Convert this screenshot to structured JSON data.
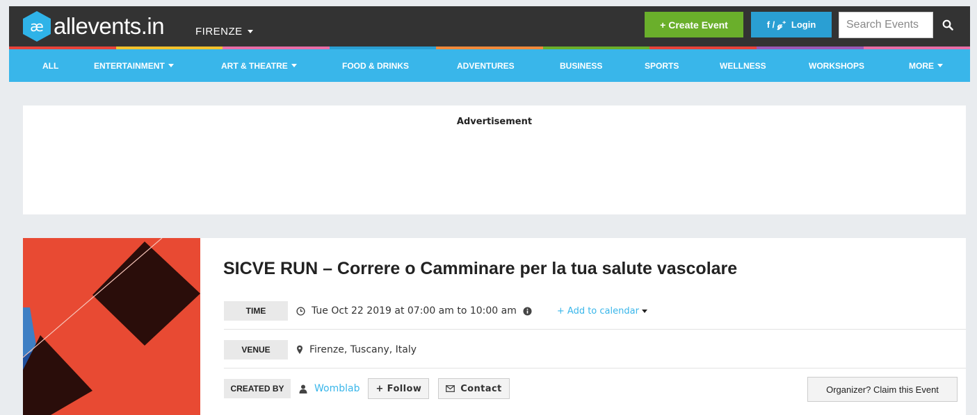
{
  "header": {
    "logo_glyph": "æ",
    "logo_text": "allevents.in",
    "city": "FIRENZE",
    "create_event": "+ Create Event",
    "login_social": "f / 𝓰⁺",
    "login": "Login",
    "search_placeholder": "Search Events"
  },
  "colors": {
    "topbar": "#333333",
    "nav": "#39b6ea",
    "create": "#6aaf2b",
    "login": "#2a9fd3",
    "strip": [
      "#e8433b",
      "#f2c22e",
      "#e96ea8",
      "#2a9fd3",
      "#f08a3c",
      "#6aaf2b",
      "#e8433b",
      "#9b59b6",
      "#e96ea8"
    ]
  },
  "nav": [
    {
      "label": "ALL",
      "dropdown": false
    },
    {
      "label": "ENTERTAINMENT",
      "dropdown": true
    },
    {
      "label": "ART & THEATRE",
      "dropdown": true
    },
    {
      "label": "FOOD & DRINKS",
      "dropdown": false
    },
    {
      "label": "ADVENTURES",
      "dropdown": false
    },
    {
      "label": "BUSINESS",
      "dropdown": false
    },
    {
      "label": "SPORTS",
      "dropdown": false
    },
    {
      "label": "WELLNESS",
      "dropdown": false
    },
    {
      "label": "WORKSHOPS",
      "dropdown": false
    },
    {
      "label": "MORE",
      "dropdown": true
    }
  ],
  "ad": {
    "label": "Advertisement"
  },
  "event": {
    "title": "SICVE RUN – Correre o Camminare per la tua salute vascolare",
    "time_label": "TIME",
    "time_value": "Tue Oct 22 2019 at 07:00 am to 10:00 am",
    "add_to_calendar": "+ Add to calendar",
    "venue_label": "VENUE",
    "venue_value": "Firenze, Tuscany, Italy",
    "created_label": "CREATED BY",
    "organizer": "Womblab",
    "follow": "+ Follow",
    "contact": "Contact",
    "claim": "Organizer? Claim this Event"
  }
}
